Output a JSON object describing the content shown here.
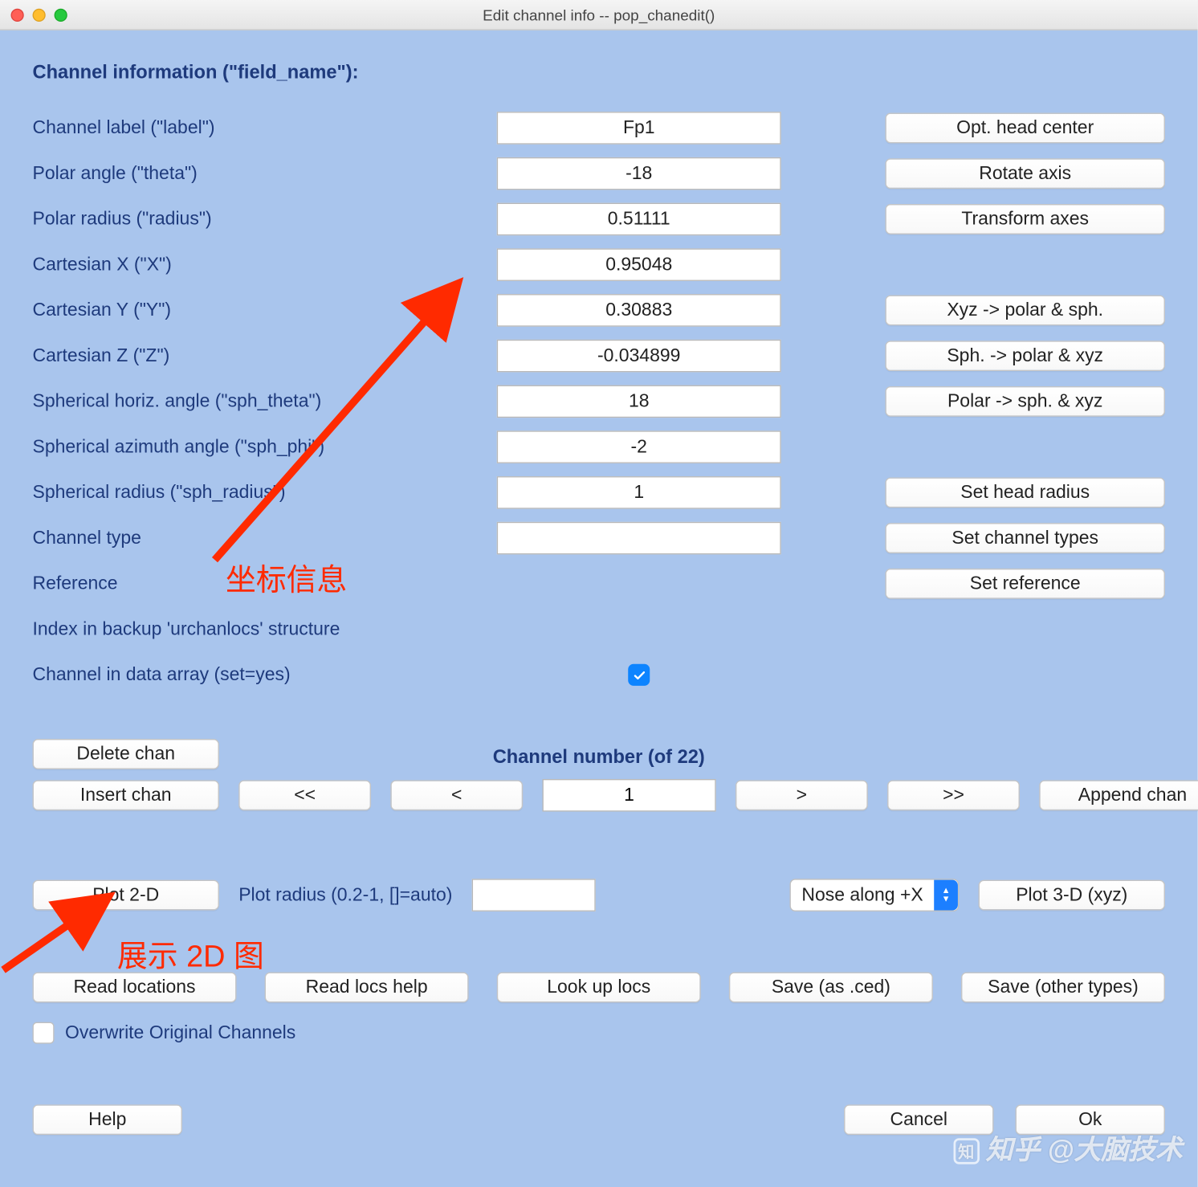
{
  "window": {
    "title": "Edit channel info -- pop_chanedit()"
  },
  "heading": "Channel information (\"field_name\"):",
  "fields": [
    {
      "label": "Channel label (\"label\")",
      "value": "Fp1"
    },
    {
      "label": "Polar angle (\"theta\")",
      "value": "-18"
    },
    {
      "label": "Polar radius (\"radius\")",
      "value": "0.51111"
    },
    {
      "label": "Cartesian X (\"X\")",
      "value": "0.95048"
    },
    {
      "label": "Cartesian Y (\"Y\")",
      "value": "0.30883"
    },
    {
      "label": "Cartesian Z (\"Z\")",
      "value": "-0.034899"
    },
    {
      "label": "Spherical horiz. angle (\"sph_theta\")",
      "value": "18"
    },
    {
      "label": "Spherical azimuth angle (\"sph_phi\")",
      "value": "-2"
    },
    {
      "label": "Spherical radius (\"sph_radius\")",
      "value": "1"
    },
    {
      "label": "Channel type",
      "value": ""
    }
  ],
  "reference_label": "Reference",
  "index_backup_label": "Index in backup 'urchanlocs' structure",
  "channel_in_data_label": "Channel in data array (set=yes)",
  "right_buttons": {
    "opt_head_center": "Opt. head center",
    "rotate_axis": "Rotate axis",
    "transform_axes": "Transform axes",
    "xyz_polar_sph": "Xyz -> polar & sph.",
    "sph_polar_xyz": "Sph. -> polar & xyz",
    "polar_sph_xyz": "Polar -> sph. & xyz",
    "set_head_radius": "Set head radius",
    "set_channel_types": "Set channel types",
    "set_reference": "Set reference"
  },
  "nav": {
    "heading": "Channel number (of 22)",
    "delete_chan": "Delete chan",
    "insert_chan": "Insert chan",
    "first": "<<",
    "prev": "<",
    "current": "1",
    "next": ">",
    "last": ">>",
    "append_chan": "Append chan"
  },
  "plot": {
    "plot2d": "Plot 2-D",
    "radius_label": "Plot radius (0.2-1, []=auto)",
    "radius_value": "",
    "nose_along": "Nose along +X",
    "plot3d": "Plot 3-D (xyz)"
  },
  "locs": {
    "read_locations": "Read locations",
    "read_locs_help": "Read locs help",
    "look_up_locs": "Look up locs",
    "save_ced": "Save (as .ced)",
    "save_other": "Save (other types)"
  },
  "overwrite_label": "Overwrite Original Channels",
  "bottom": {
    "help": "Help",
    "cancel": "Cancel",
    "ok": "Ok"
  },
  "annotations": {
    "coord_info": "坐标信息",
    "show_2d": "展示 2D 图"
  },
  "watermark": "知乎 @大脑技术"
}
